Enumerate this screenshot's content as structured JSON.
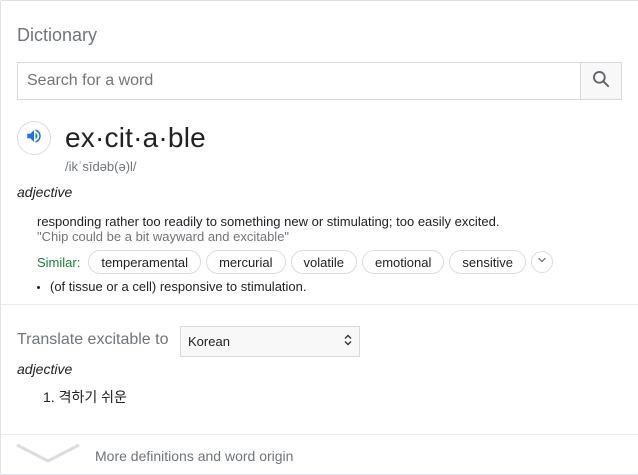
{
  "header": {
    "title": "Dictionary"
  },
  "search": {
    "placeholder": "Search for a word",
    "value": ""
  },
  "entry": {
    "word": "ex·cit·a·ble",
    "phonetic": "/ikˈsīdəb(ə)l/",
    "part_of_speech": "adjective",
    "definition": "responding rather too readily to something new or stimulating; too easily excited.",
    "example": "\"Chip could be a bit wayward and excitable\"",
    "similar_label": "Similar:",
    "similar": [
      "temperamental",
      "mercurial",
      "volatile",
      "emotional",
      "sensitive"
    ],
    "sense_2": "(of tissue or a cell) responsive to stimulation."
  },
  "translate": {
    "label": "Translate excitable to",
    "language": "Korean",
    "part_of_speech": "adjective",
    "results": [
      "1. 격하기 쉬운"
    ]
  },
  "footer": {
    "more_label": "More definitions and word origin"
  },
  "icons": {
    "search": "search-icon",
    "speaker": "speaker-icon",
    "expand": "chevron-down-icon",
    "select_arrows": "select-arrows-icon",
    "more": "chevron-down-icon"
  },
  "colors": {
    "accent_blue": "#1a73e8",
    "similar_green": "#188038",
    "muted_text": "#70757a"
  }
}
